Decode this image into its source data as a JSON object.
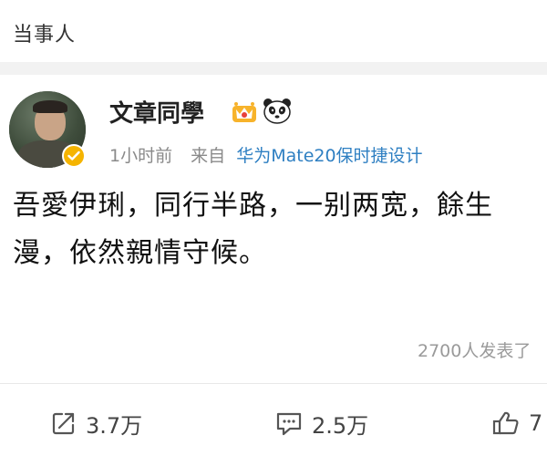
{
  "top_bar": {
    "title": "当事人"
  },
  "post": {
    "author": "文章同學",
    "badges": [
      "crown-badge-icon",
      "panda-badge-icon"
    ],
    "time": "1小时前",
    "source_label": "来自",
    "device": "华为Mate20保时捷设计",
    "content_line1": "吾愛伊琍，同行半路，一别两宽，餘生",
    "content_line2": "漫，依然親情守候。",
    "read_count": "2700人发表了",
    "accent_color": "#2e7fc2",
    "verified_color": "#f5b400"
  },
  "actions": {
    "repost_count": "3.7万",
    "comment_count": "2.5万",
    "like_count": "7"
  }
}
